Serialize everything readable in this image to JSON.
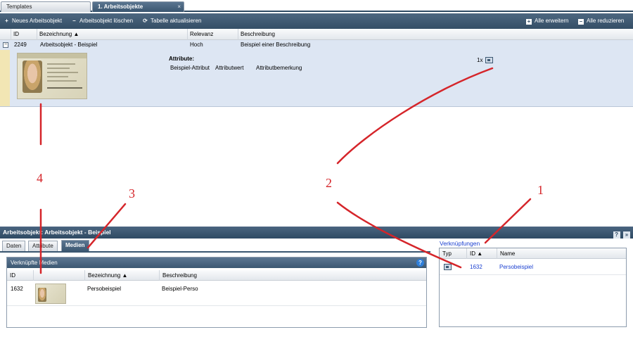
{
  "tabs": [
    {
      "label": "Templates"
    },
    {
      "label": "1. Arbeitsobjekte",
      "close": "×"
    }
  ],
  "toolbar": {
    "new_label": "Neues Arbeitsobjekt",
    "delete_label": "Arbeitsobjekt löschen",
    "refresh_label": "Tabelle aktualisieren",
    "expand_all_label": "Alle erweitern",
    "collapse_all_label": "Alle reduzieren"
  },
  "table": {
    "columns": [
      "ID",
      "Bezeichnung ▲",
      "Relevanz",
      "Beschreibung"
    ],
    "row": {
      "expander": "−",
      "id": "2249",
      "name": "Arbeitsobjekt - Beispiel",
      "relevance": "Hoch",
      "description": "Beispiel einer Beschreibung",
      "attributes_title": "Attribute:",
      "attribute_name": "Beispiel-Attribut",
      "attribute_value": "Attributwert",
      "attribute_remark": "Attributbemerkung",
      "media_count": "1x"
    }
  },
  "detail": {
    "title": "Arbeitsobjekt: Arbeitsobjekt - Beispiel",
    "help_label": "?",
    "collapse_label": "»",
    "subtabs": [
      "Daten",
      "Attribute",
      "Medien"
    ],
    "media_panel": {
      "title": "Verknüpfte Medien",
      "help_label": "?",
      "columns": [
        "ID",
        "",
        "Bezeichnung ▲",
        "Beschreibung"
      ],
      "row": {
        "id": "1632",
        "name": "Persobeispiel",
        "description": "Beispiel-Perso"
      }
    },
    "links": {
      "title": "Verknüpfungen",
      "columns": [
        "Typ",
        "ID ▲",
        "Name"
      ],
      "row": {
        "id": "1632",
        "name": "Persobeispiel"
      }
    }
  },
  "annotations": {
    "labels": [
      "1",
      "2",
      "3",
      "4"
    ],
    "color": "#d5252a"
  },
  "colors": {
    "header": "#344e66",
    "row_selected": "#dde6f3",
    "link": "#1a3fd0"
  }
}
